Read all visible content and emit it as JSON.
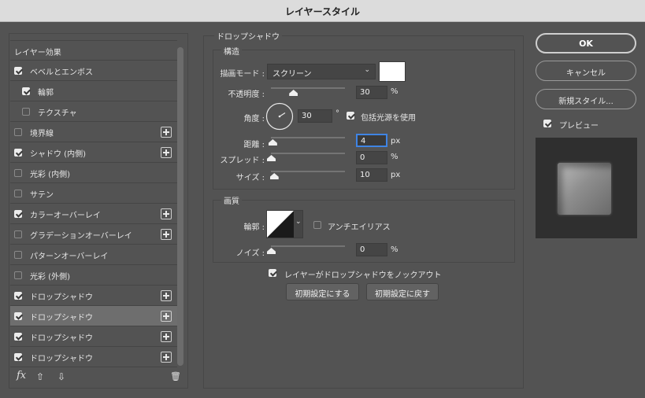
{
  "window": {
    "title": "レイヤースタイル"
  },
  "left_panel": {
    "header": "レイヤー効果",
    "items": [
      {
        "label": "ベベルとエンボス",
        "checked": true,
        "plus": false,
        "indent": 0
      },
      {
        "label": "輪郭",
        "checked": true,
        "plus": false,
        "indent": 1
      },
      {
        "label": "テクスチャ",
        "checked": false,
        "plus": false,
        "indent": 1
      },
      {
        "label": "境界線",
        "checked": false,
        "plus": true,
        "indent": 0
      },
      {
        "label": "シャドウ (内側)",
        "checked": true,
        "plus": true,
        "indent": 0
      },
      {
        "label": "光彩 (内側)",
        "checked": false,
        "plus": false,
        "indent": 0
      },
      {
        "label": "サテン",
        "checked": false,
        "plus": false,
        "indent": 0
      },
      {
        "label": "カラーオーバーレイ",
        "checked": true,
        "plus": true,
        "indent": 0
      },
      {
        "label": "グラデーションオーバーレイ",
        "checked": false,
        "plus": true,
        "indent": 0
      },
      {
        "label": "パターンオーバーレイ",
        "checked": false,
        "plus": false,
        "indent": 0
      },
      {
        "label": "光彩 (外側)",
        "checked": false,
        "plus": false,
        "indent": 0
      },
      {
        "label": "ドロップシャドウ",
        "checked": true,
        "plus": true,
        "indent": 0,
        "selected": false
      },
      {
        "label": "ドロップシャドウ",
        "checked": true,
        "plus": true,
        "indent": 0,
        "selected": true
      },
      {
        "label": "ドロップシャドウ",
        "checked": true,
        "plus": true,
        "indent": 0,
        "selected": false
      },
      {
        "label": "ドロップシャドウ",
        "checked": true,
        "plus": true,
        "indent": 0,
        "selected": false
      }
    ],
    "tools": {
      "fx": "fx",
      "up": "⇧",
      "down": "⇩",
      "trash": "🗑"
    }
  },
  "drop_shadow": {
    "title": "ドロップシャドウ",
    "structure": {
      "title": "構造",
      "blend_mode_label": "描画モード :",
      "blend_mode_value": "スクリーン",
      "blend_color": "#ffffff",
      "opacity_label": "不透明度 :",
      "opacity_value": "30",
      "opacity_unit": "%",
      "opacity_level": 0.3,
      "angle_label": "角度 :",
      "angle_value": "30",
      "angle_unit": "°",
      "global_light_label": "包括光源を使用",
      "global_light_checked": true,
      "distance_label": "距離 :",
      "distance_value": "4",
      "distance_unit": "px",
      "distance_level": 0.02,
      "spread_label": "スプレッド :",
      "spread_value": "0",
      "spread_unit": "%",
      "spread_level": 0.0,
      "size_label": "サイズ :",
      "size_value": "10",
      "size_unit": "px",
      "size_level": 0.04
    },
    "quality": {
      "title": "画質",
      "contour_label": "輪郭 :",
      "anti_alias_label": "アンチエイリアス",
      "anti_alias_checked": false,
      "noise_label": "ノイズ :",
      "noise_value": "0",
      "noise_unit": "%",
      "noise_level": 0.0
    },
    "knockout_label": "レイヤーがドロップシャドウをノックアウト",
    "knockout_checked": true,
    "make_default_label": "初期設定にする",
    "reset_default_label": "初期設定に戻す"
  },
  "buttons": {
    "ok": "OK",
    "cancel": "キャンセル",
    "new_style": "新規スタイル...",
    "preview_label": "プレビュー",
    "preview_checked": true
  }
}
